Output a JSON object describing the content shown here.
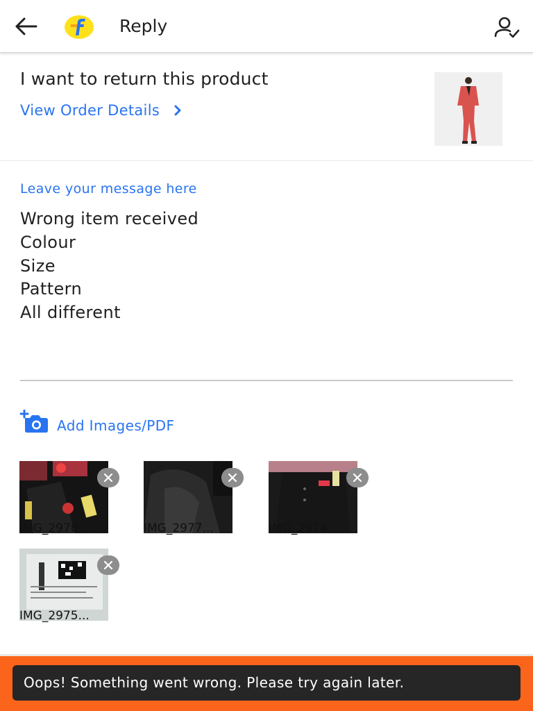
{
  "header": {
    "back_icon": "arrow-left-icon",
    "logo": "flipkart-logo",
    "title": "Reply",
    "account_icon": "user-check-icon"
  },
  "order": {
    "title": "I want to return this product",
    "link_label": "View Order Details",
    "link_icon": "chevron-right-icon",
    "thumbnail": "red suit product image"
  },
  "message": {
    "label": "Leave your message here",
    "lines": [
      "Wrong item received",
      "Colour",
      "Size",
      "Pattern",
      "All different"
    ]
  },
  "attachments": {
    "add_label": "Add Images/PDF",
    "add_icon": "add-camera-icon",
    "items": [
      {
        "name": "IMG_2976..."
      },
      {
        "name": "IMG_2977..."
      },
      {
        "name": "IMG_2974..."
      },
      {
        "name": "IMG_2975..."
      }
    ]
  },
  "toast": {
    "message": "Oops! Something went wrong. Please try again later."
  },
  "colors": {
    "accent_blue": "#2874f0",
    "bottom_bar_orange": "#fb641b",
    "toast_bg": "#262626",
    "logo_yellow": "#ffe11b"
  }
}
